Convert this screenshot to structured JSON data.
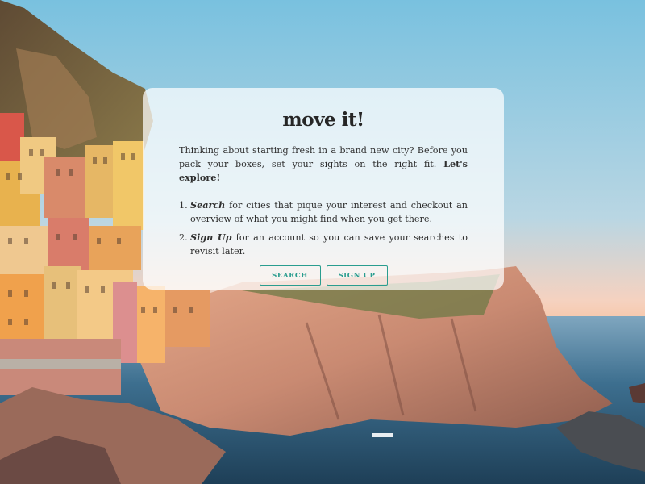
{
  "card": {
    "title": "move it!",
    "intro_text": "Thinking about starting fresh in a brand new city? Before you pack your boxes, set your sights on the right fit.",
    "intro_cta": "Let's explore!",
    "steps": [
      {
        "number": "1.",
        "keyword": "Search",
        "text": "for cities that pique your interest and checkout an overview of what you might find when you get there."
      },
      {
        "number": "2.",
        "keyword": "Sign Up",
        "text": "for an account so you can save your searches to revisit later."
      }
    ],
    "buttons": {
      "search_label": "SEARCH",
      "signup_label": "SIGN UP"
    }
  },
  "colors": {
    "accent": "#2a9d8f",
    "sky_top": "#7cc3e0",
    "sky_bottom": "#f7c7a8",
    "sea": "#2c5f80"
  }
}
